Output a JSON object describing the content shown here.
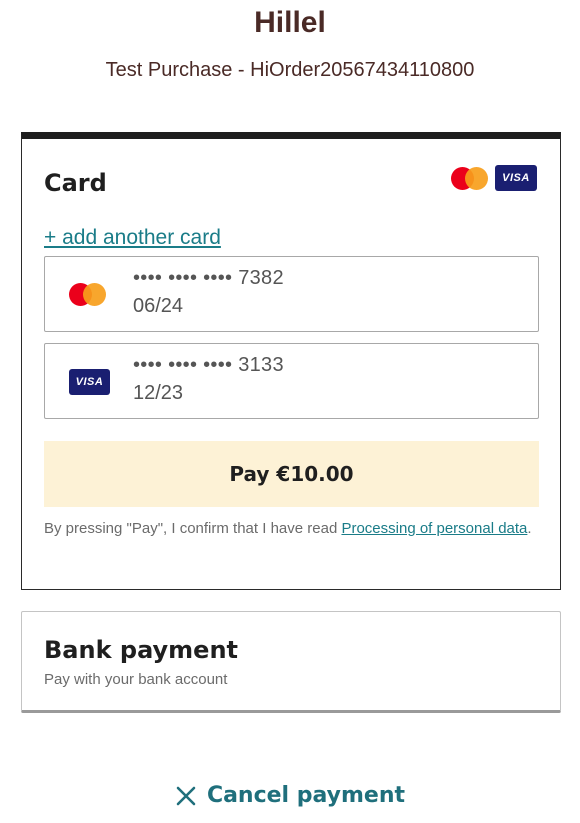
{
  "header": {
    "merchant": "Hillel",
    "order_description": "Test Purchase - HiOrder20567434110800"
  },
  "card_section": {
    "title": "Card",
    "accepted_brand_icons": [
      "mastercard-icon",
      "visa-icon"
    ],
    "visa_text": "VISA",
    "add_card_label": "+ add another card",
    "saved_cards": [
      {
        "brand": "mastercard",
        "masked_number": "•••• •••• •••• 7382",
        "expiry": "06/24"
      },
      {
        "brand": "visa",
        "brand_text": "VISA",
        "masked_number": "•••• •••• •••• 3133",
        "expiry": "12/23"
      }
    ],
    "pay_button_label": "Pay €10.00",
    "consent_text": "By pressing \"Pay\", I confirm that I have read ",
    "consent_link": "Processing of personal data",
    "consent_end": "."
  },
  "bank_section": {
    "title": "Bank payment",
    "subtitle": "Pay with your bank account"
  },
  "cancel": {
    "label": "Cancel payment",
    "icon": "close-icon"
  },
  "colors": {
    "title_brown": "#4a2a26",
    "link_teal": "#1a7c88",
    "pay_button_bg": "#fdf2d6",
    "cancel_teal": "#1f6f7c",
    "mastercard_red": "#eb001b",
    "mastercard_orange": "#f79e1b",
    "visa_navy": "#1a1f71"
  }
}
